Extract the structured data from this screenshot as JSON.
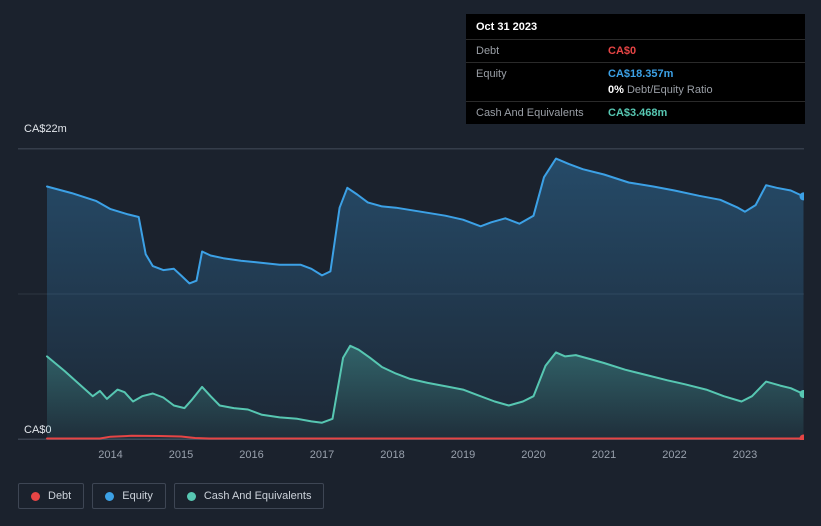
{
  "axis": {
    "y_top_label": "CA$22m",
    "y_bottom_label": "CA$0",
    "x_ticks": [
      2014,
      2015,
      2016,
      2017,
      2018,
      2019,
      2020,
      2021,
      2022,
      2023
    ]
  },
  "tooltip": {
    "date": "Oct 31 2023",
    "debt_label": "Debt",
    "debt_value": "CA$0",
    "equity_label": "Equity",
    "equity_value": "CA$18.357m",
    "ratio_value": "0%",
    "ratio_label": "Debt/Equity Ratio",
    "cash_label": "Cash And Equivalents",
    "cash_value": "CA$3.468m"
  },
  "legend": [
    {
      "label": "Debt",
      "color": "#e64545"
    },
    {
      "label": "Equity",
      "color": "#3ca1e6"
    },
    {
      "label": "Cash And Equivalents",
      "color": "#57c7b2"
    }
  ],
  "colors": {
    "background": "#1b222d",
    "grid_top": "#353d4a",
    "grid_mid": "#272f3b",
    "grid_bottom": "#3a4250",
    "debt": "#e64545",
    "equity": "#3ca1e6",
    "cash": "#57c7b2"
  },
  "chart_data": {
    "type": "area",
    "title": "",
    "xlabel": "",
    "ylabel": "CA$ (millions)",
    "x_range": [
      2013.1,
      2023.83
    ],
    "y_range": [
      0,
      22
    ],
    "grid": "horizontal",
    "legend_position": "bottom-left",
    "series": [
      {
        "name": "Equity",
        "color": "#3ca1e6",
        "area": true,
        "points": [
          [
            2013.1,
            19.1
          ],
          [
            2013.45,
            18.6
          ],
          [
            2013.8,
            18.0
          ],
          [
            2014.0,
            17.4
          ],
          [
            2014.25,
            17.0
          ],
          [
            2014.4,
            16.8
          ],
          [
            2014.5,
            14.0
          ],
          [
            2014.6,
            13.1
          ],
          [
            2014.75,
            12.8
          ],
          [
            2014.9,
            12.9
          ],
          [
            2015.0,
            12.4
          ],
          [
            2015.12,
            11.8
          ],
          [
            2015.22,
            12.0
          ],
          [
            2015.3,
            14.2
          ],
          [
            2015.42,
            13.9
          ],
          [
            2015.6,
            13.7
          ],
          [
            2015.85,
            13.5
          ],
          [
            2016.05,
            13.4
          ],
          [
            2016.4,
            13.2
          ],
          [
            2016.7,
            13.2
          ],
          [
            2016.85,
            12.9
          ],
          [
            2017.0,
            12.4
          ],
          [
            2017.12,
            12.7
          ],
          [
            2017.25,
            17.5
          ],
          [
            2017.36,
            19.0
          ],
          [
            2017.5,
            18.5
          ],
          [
            2017.65,
            17.9
          ],
          [
            2017.85,
            17.6
          ],
          [
            2018.05,
            17.5
          ],
          [
            2018.4,
            17.2
          ],
          [
            2018.75,
            16.9
          ],
          [
            2019.0,
            16.6
          ],
          [
            2019.25,
            16.1
          ],
          [
            2019.4,
            16.4
          ],
          [
            2019.6,
            16.7
          ],
          [
            2019.8,
            16.3
          ],
          [
            2020.0,
            16.9
          ],
          [
            2020.15,
            19.8
          ],
          [
            2020.32,
            21.2
          ],
          [
            2020.5,
            20.8
          ],
          [
            2020.7,
            20.4
          ],
          [
            2021.0,
            20.0
          ],
          [
            2021.35,
            19.4
          ],
          [
            2021.7,
            19.1
          ],
          [
            2022.0,
            18.8
          ],
          [
            2022.35,
            18.4
          ],
          [
            2022.65,
            18.1
          ],
          [
            2022.9,
            17.5
          ],
          [
            2023.0,
            17.2
          ],
          [
            2023.15,
            17.7
          ],
          [
            2023.3,
            19.2
          ],
          [
            2023.45,
            19.0
          ],
          [
            2023.65,
            18.8
          ],
          [
            2023.83,
            18.357
          ]
        ]
      },
      {
        "name": "Cash And Equivalents",
        "color": "#57c7b2",
        "area": true,
        "points": [
          [
            2013.1,
            6.3
          ],
          [
            2013.35,
            5.2
          ],
          [
            2013.6,
            4.0
          ],
          [
            2013.75,
            3.3
          ],
          [
            2013.85,
            3.7
          ],
          [
            2013.95,
            3.1
          ],
          [
            2014.1,
            3.8
          ],
          [
            2014.2,
            3.6
          ],
          [
            2014.32,
            2.9
          ],
          [
            2014.45,
            3.3
          ],
          [
            2014.6,
            3.5
          ],
          [
            2014.75,
            3.2
          ],
          [
            2014.9,
            2.6
          ],
          [
            2015.05,
            2.4
          ],
          [
            2015.15,
            3.0
          ],
          [
            2015.3,
            4.0
          ],
          [
            2015.42,
            3.3
          ],
          [
            2015.55,
            2.6
          ],
          [
            2015.75,
            2.4
          ],
          [
            2015.95,
            2.3
          ],
          [
            2016.15,
            1.9
          ],
          [
            2016.4,
            1.7
          ],
          [
            2016.65,
            1.6
          ],
          [
            2016.85,
            1.4
          ],
          [
            2017.0,
            1.3
          ],
          [
            2017.15,
            1.6
          ],
          [
            2017.3,
            6.2
          ],
          [
            2017.4,
            7.1
          ],
          [
            2017.52,
            6.8
          ],
          [
            2017.68,
            6.2
          ],
          [
            2017.85,
            5.5
          ],
          [
            2018.05,
            5.0
          ],
          [
            2018.25,
            4.6
          ],
          [
            2018.5,
            4.3
          ],
          [
            2018.8,
            4.0
          ],
          [
            2019.0,
            3.8
          ],
          [
            2019.2,
            3.4
          ],
          [
            2019.45,
            2.9
          ],
          [
            2019.65,
            2.6
          ],
          [
            2019.85,
            2.9
          ],
          [
            2020.0,
            3.3
          ],
          [
            2020.17,
            5.6
          ],
          [
            2020.32,
            6.6
          ],
          [
            2020.45,
            6.3
          ],
          [
            2020.6,
            6.4
          ],
          [
            2020.8,
            6.1
          ],
          [
            2021.0,
            5.8
          ],
          [
            2021.3,
            5.3
          ],
          [
            2021.6,
            4.9
          ],
          [
            2021.9,
            4.5
          ],
          [
            2022.15,
            4.2
          ],
          [
            2022.45,
            3.8
          ],
          [
            2022.7,
            3.3
          ],
          [
            2022.95,
            2.9
          ],
          [
            2023.1,
            3.3
          ],
          [
            2023.3,
            4.4
          ],
          [
            2023.5,
            4.1
          ],
          [
            2023.65,
            3.9
          ],
          [
            2023.83,
            3.468
          ]
        ]
      },
      {
        "name": "Debt",
        "color": "#e64545",
        "area": false,
        "points": [
          [
            2013.1,
            0
          ],
          [
            2013.85,
            0
          ],
          [
            2014.0,
            0.25
          ],
          [
            2014.3,
            0.32
          ],
          [
            2014.7,
            0.3
          ],
          [
            2015.0,
            0.26
          ],
          [
            2015.2,
            0.15
          ],
          [
            2015.4,
            0.03
          ],
          [
            2015.55,
            0
          ],
          [
            2023.83,
            0
          ]
        ]
      }
    ]
  }
}
